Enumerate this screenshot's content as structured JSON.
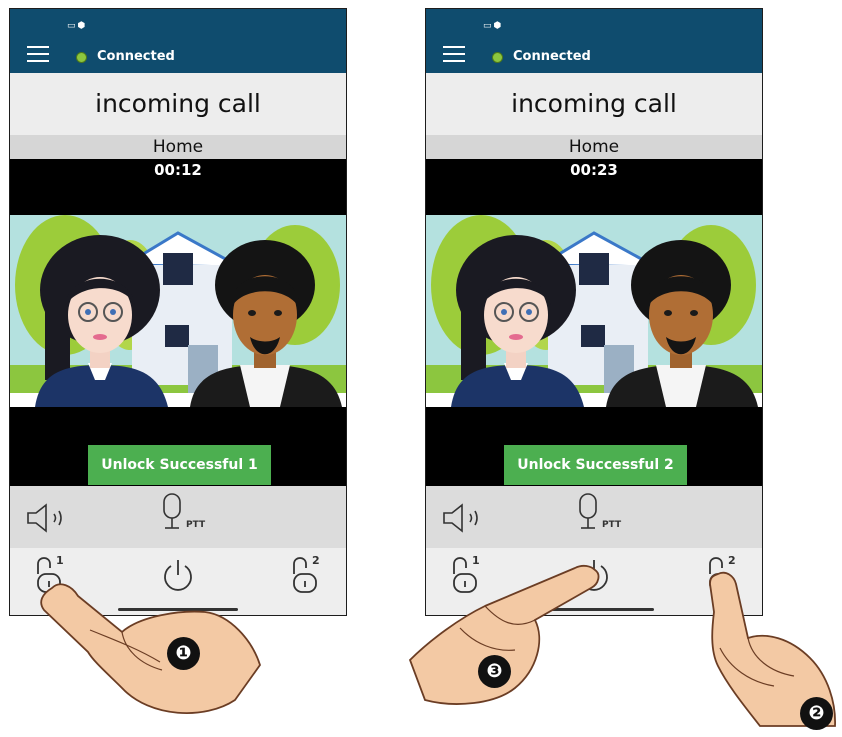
{
  "screens": [
    {
      "status": "Connected",
      "title": "incoming call",
      "location": "Home",
      "timer": "00:12",
      "unlock_message": "Unlock Successful 1",
      "ptt_label": "PTT",
      "lock1_number": "1",
      "lock2_number": "2"
    },
    {
      "status": "Connected",
      "title": "incoming call",
      "location": "Home",
      "timer": "00:23",
      "unlock_message": "Unlock Successful 2",
      "ptt_label": "PTT",
      "lock1_number": "1",
      "lock2_number": "2"
    }
  ],
  "step_badges": [
    "❶",
    "❷",
    "❸"
  ],
  "colors": {
    "header": "#0f4c6e",
    "connected_dot": "#8cc63f",
    "unlock_success": "#4caf50",
    "video_background": "#000000"
  },
  "icons": [
    "camera-icon",
    "shield-icon",
    "menu-icon",
    "speaker-icon",
    "microphone-icon",
    "unlock-icon",
    "power-icon"
  ]
}
